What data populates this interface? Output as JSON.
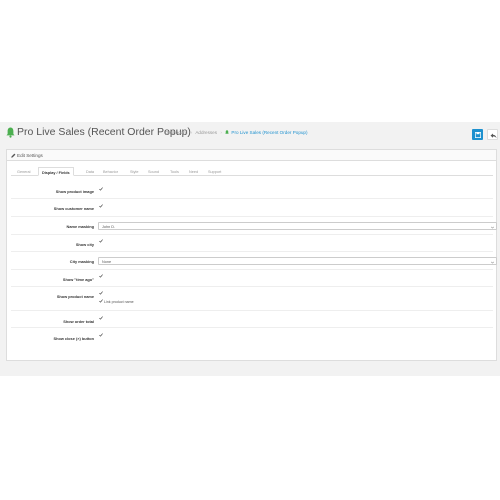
{
  "header": {
    "title": "Pro Live Sales (Recent Order Popup)",
    "breadcrumbs": [
      "Dashboard",
      "Addresses"
    ],
    "current": "Pro Live Sales (Recent Order Popup)",
    "save_icon": "save-icon",
    "back_icon": "reply-icon"
  },
  "panel": {
    "heading": "Edit Settings",
    "tabs": [
      "General",
      "Display / Fields",
      "Data",
      "Behavior",
      "Style",
      "Sound",
      "Tools",
      "Need",
      "Support"
    ],
    "active_tab": "Display / Fields"
  },
  "fields": {
    "show_product_image": {
      "label": "Show product image",
      "checked": true
    },
    "show_customer_name": {
      "label": "Show customer name",
      "checked": true
    },
    "name_masking": {
      "label": "Name masking",
      "value": "John D."
    },
    "show_city": {
      "label": "Show city",
      "checked": true
    },
    "city_masking": {
      "label": "City masking",
      "value": "None"
    },
    "show_time_ago": {
      "label": "Show \"time ago\"",
      "checked": true
    },
    "show_product_name": {
      "label": "Show product name",
      "checked": true,
      "sub_label": "Link product name",
      "sub_checked": true
    },
    "show_order_total": {
      "label": "Show order total",
      "checked": true
    },
    "show_close_button": {
      "label": "Show close (×) button",
      "checked": true
    }
  },
  "colors": {
    "accent": "#1e91cf",
    "bell": "#4caf50",
    "background": "#f2f2f2"
  }
}
